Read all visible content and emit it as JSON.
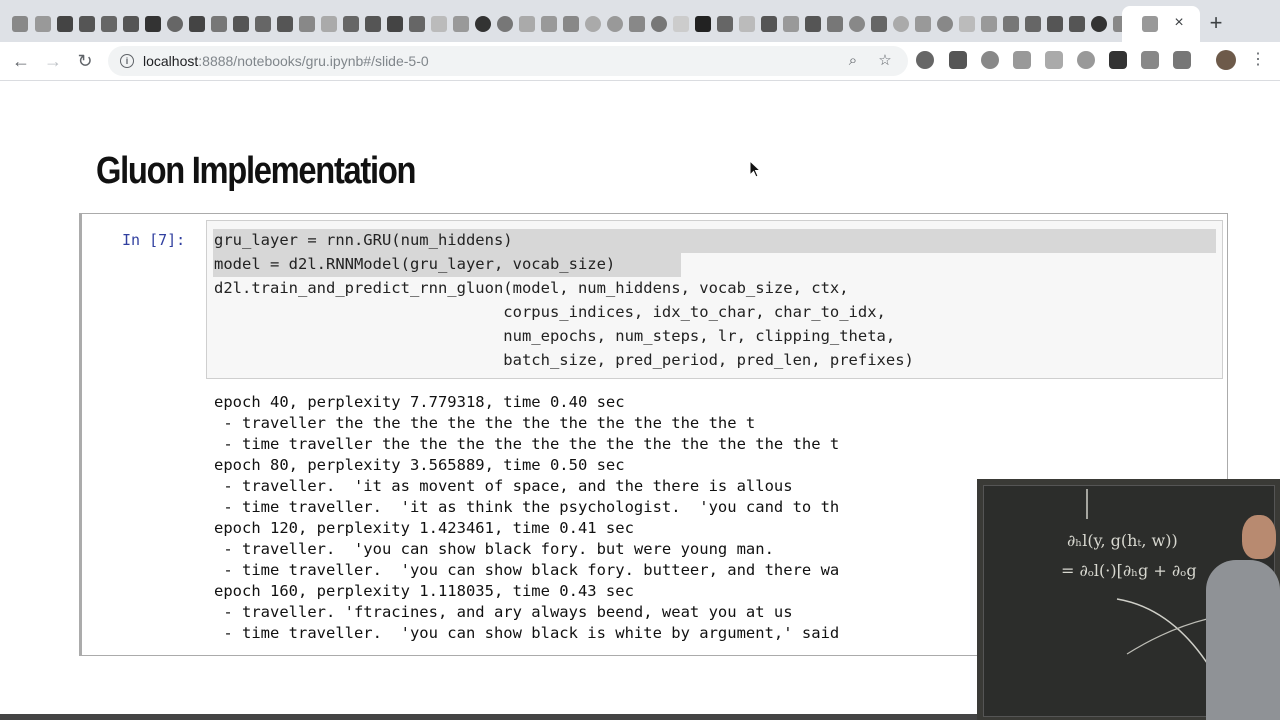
{
  "browser": {
    "url_host": "localhost",
    "url_rest": ":8888/notebooks/gru.ipynb#/slide-5-0",
    "tab_close": "×",
    "new_tab": "+",
    "nav": {
      "back": "←",
      "forward": "→",
      "reload": "↻"
    },
    "omnibox_icons": {
      "search": "⌕",
      "bookmark": "☆"
    },
    "menu": "⋮"
  },
  "colors": {
    "prompt": "#303f9f",
    "input_bg": "#f7f7f7",
    "selection": "#d7d7d7"
  },
  "notebook": {
    "heading": "Gluon Implementation",
    "cell": {
      "prompt": "In [7]:",
      "code": [
        "gru_layer = rnn.GRU(num_hiddens)",
        "model = d2l.RNNModel(gru_layer, vocab_size)",
        "d2l.train_and_predict_rnn_gluon(model, num_hiddens, vocab_size, ctx,",
        "                               corpus_indices, idx_to_char, char_to_idx,",
        "                               num_epochs, num_steps, lr, clipping_theta,",
        "                               batch_size, pred_period, pred_len, prefixes)"
      ],
      "output": [
        "epoch 40, perplexity 7.779318, time 0.40 sec",
        " - traveller the the the the the the the the the the the t",
        " - time traveller the the the the the the the the the the the the t",
        "epoch 80, perplexity 3.565889, time 0.50 sec",
        " - traveller.  'it as movent of space, and the there is allous",
        " - time traveller.  'it as think the psychologist.  'you cand to th",
        "epoch 120, perplexity 1.423461, time 0.41 sec",
        " - traveller.  'you can show black fory. but were young man.",
        " - time traveller.  'you can show black fory. butteer, and there wa",
        "epoch 160, perplexity 1.118035, time 0.43 sec",
        " - traveller. 'ftracines, and ary always beend, weat you at us",
        " - time traveller.  'you can show black is white by argument,' said"
      ]
    }
  },
  "video": {
    "chalk_lines": [
      "∂ₕl(y, g(hₜ, w))",
      "= ∂ₒl(·)[∂ₕg + ∂ₒg"
    ]
  }
}
